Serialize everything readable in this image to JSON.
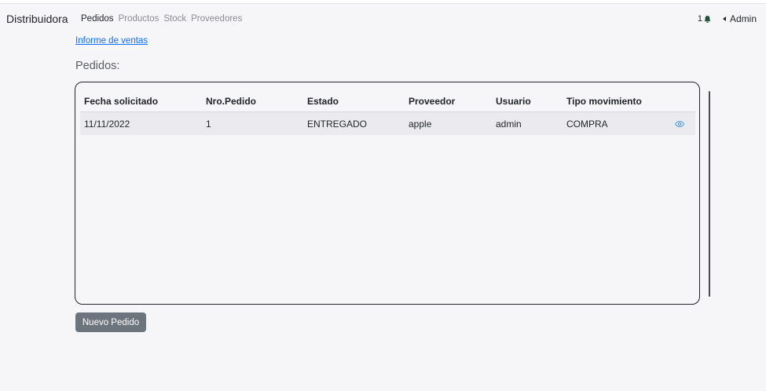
{
  "navbar": {
    "brand": "Distribuidora",
    "links": [
      "Pedidos",
      "Productos",
      "Stock",
      "Proveedores"
    ],
    "notification_count": "1",
    "user": "Admin"
  },
  "report_link": "Informe de ventas",
  "section_title": "Pedidos:",
  "table": {
    "columns": [
      "Fecha solicitado",
      "Nro.Pedido",
      "Estado",
      "Proveedor",
      "Usuario",
      "Tipo movimiento"
    ],
    "rows": [
      [
        "11/11/2022",
        "1",
        "ENTREGADO",
        "apple",
        "admin",
        "COMPRA"
      ]
    ]
  },
  "new_order_button": "Nuevo Pedido",
  "colors": {
    "accent_link": "#0d6efd",
    "button": "#6c757d",
    "bell": "#1f5138",
    "eye_icon": "#3b8fd9"
  },
  "icons": {
    "notification": "bell-icon",
    "user_caret": "caret-left-icon",
    "row_action": "eye-icon"
  }
}
